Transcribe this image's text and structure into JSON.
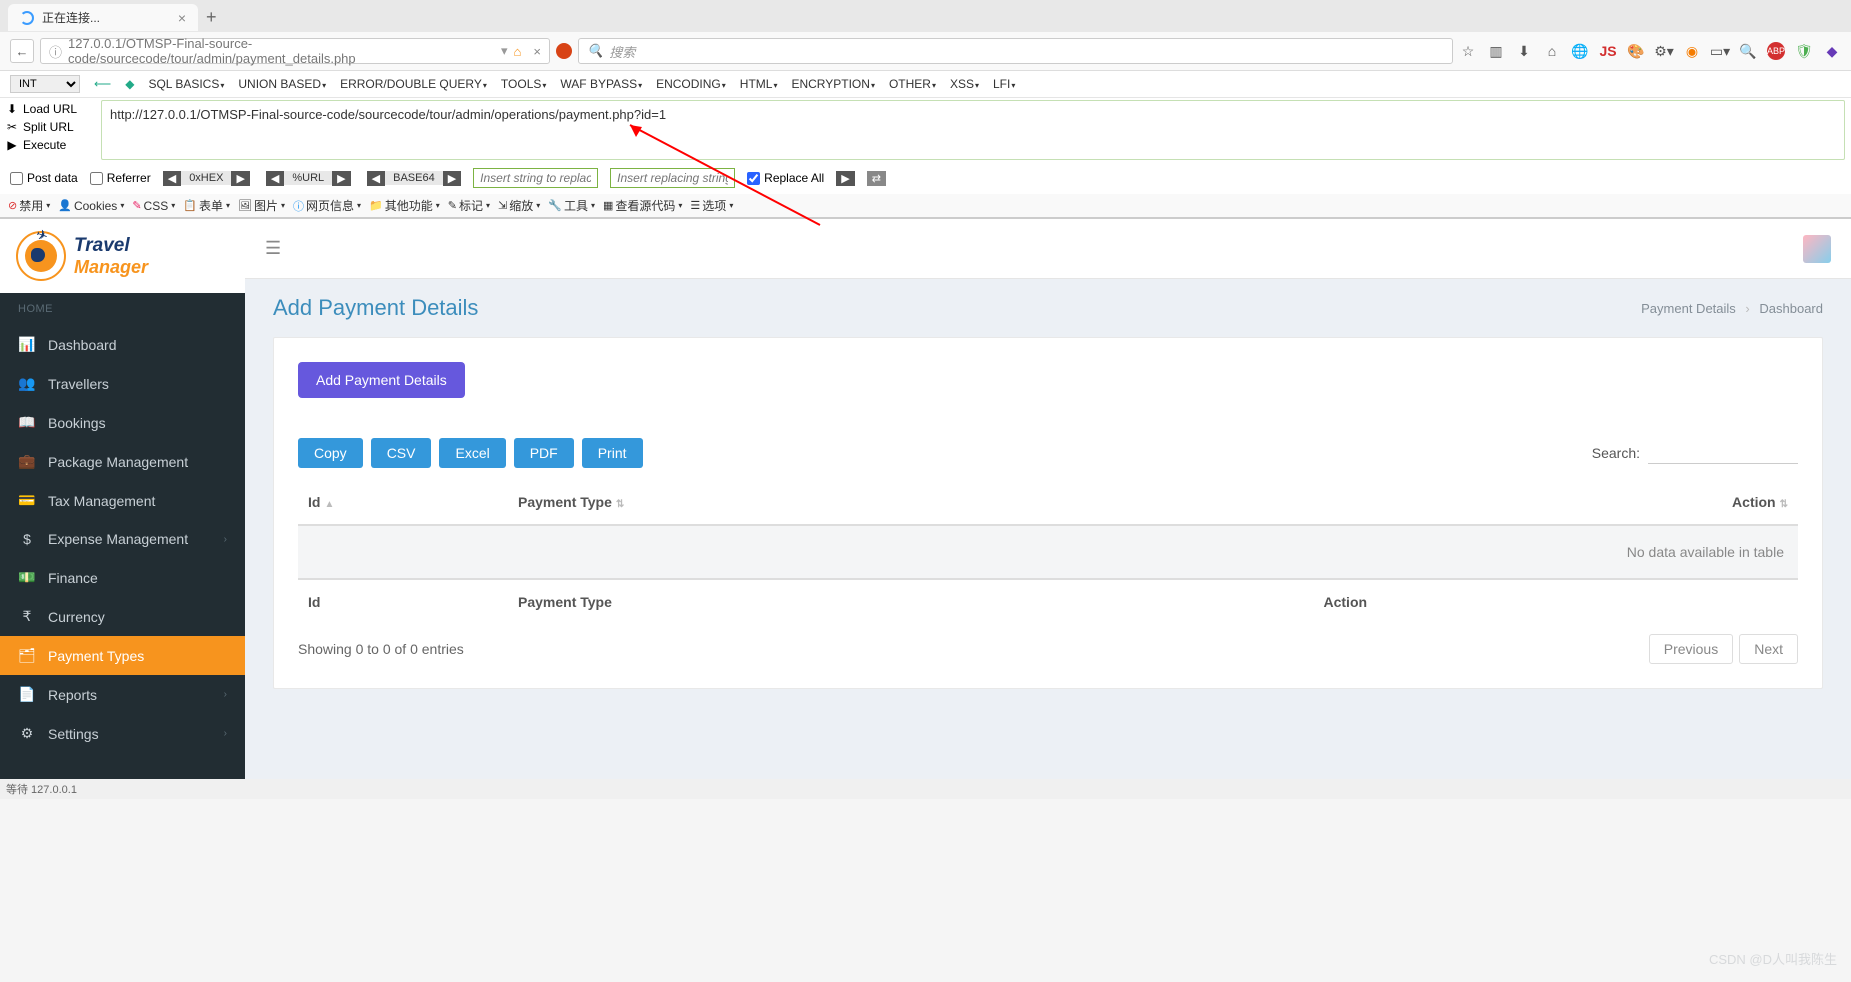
{
  "browser": {
    "tab_title": "正在连接...",
    "url": "127.0.0.1/OTMSP-Final-source-code/sourcecode/tour/admin/payment_details.php",
    "search_placeholder": "搜索",
    "status": "等待 127.0.0.1"
  },
  "hackbar": {
    "select": "INT",
    "menu": [
      "SQL BASICS",
      "UNION BASED",
      "ERROR/DOUBLE QUERY",
      "TOOLS",
      "WAF BYPASS",
      "ENCODING",
      "HTML",
      "ENCRYPTION",
      "OTHER",
      "XSS",
      "LFI"
    ],
    "left": [
      {
        "icon": "⬇",
        "label": "Load URL"
      },
      {
        "icon": "✂",
        "label": "Split URL"
      },
      {
        "icon": "▶",
        "label": "Execute"
      }
    ],
    "url_input": "http://127.0.0.1/OTMSP-Final-source-code/sourcecode/tour/admin/operations/payment.php?id=1",
    "post_data": "Post data",
    "referrer": "Referrer",
    "hex_buttons": [
      "0xHEX",
      "%URL",
      "BASE64"
    ],
    "replace_placeholder1": "Insert string to replace",
    "replace_placeholder2": "Insert replacing string",
    "replace_all": "Replace All"
  },
  "devtools": [
    {
      "icon": "⊘",
      "label": "禁用",
      "color": "#d33"
    },
    {
      "icon": "👤",
      "label": "Cookies"
    },
    {
      "icon": "✎",
      "label": "CSS",
      "color": "#e91e63"
    },
    {
      "icon": "📋",
      "label": "表单"
    },
    {
      "icon": "🖼",
      "label": "图片"
    },
    {
      "icon": "ⓘ",
      "label": "网页信息",
      "color": "#2196f3"
    },
    {
      "icon": "📁",
      "label": "其他功能"
    },
    {
      "icon": "✎",
      "label": "标记"
    },
    {
      "icon": "⇲",
      "label": "缩放"
    },
    {
      "icon": "🔧",
      "label": "工具"
    },
    {
      "icon": "▦",
      "label": "查看源代码"
    },
    {
      "icon": "☰",
      "label": "选项"
    }
  ],
  "logo": {
    "line1": "Travel",
    "line2": "Manager"
  },
  "sidebar": {
    "section": "HOME",
    "items": [
      {
        "icon": "📊",
        "label": "Dashboard"
      },
      {
        "icon": "👥",
        "label": "Travellers"
      },
      {
        "icon": "📖",
        "label": "Bookings"
      },
      {
        "icon": "💼",
        "label": "Package Management"
      },
      {
        "icon": "💳",
        "label": "Tax Management"
      },
      {
        "icon": "$",
        "label": "Expense Management",
        "chev": true
      },
      {
        "icon": "💵",
        "label": "Finance"
      },
      {
        "icon": "₹",
        "label": "Currency"
      },
      {
        "icon": "🗂",
        "label": "Payment Types",
        "active": true
      },
      {
        "icon": "📄",
        "label": "Reports",
        "chev": true
      },
      {
        "icon": "⚙",
        "label": "Settings",
        "chev": true
      }
    ]
  },
  "page": {
    "title": "Add Payment Details",
    "breadcrumb": [
      "Payment Details",
      "Dashboard"
    ],
    "add_button": "Add Payment Details",
    "export_buttons": [
      "Copy",
      "CSV",
      "Excel",
      "PDF",
      "Print"
    ],
    "search_label": "Search:",
    "columns": [
      "Id",
      "Payment Type",
      "Action"
    ],
    "empty_message": "No data available in table",
    "footer_columns": [
      "Id",
      "Payment Type",
      "Action"
    ],
    "info": "Showing 0 to 0 of 0 entries",
    "prev": "Previous",
    "next": "Next"
  },
  "watermark": "CSDN @D人叫我陈生"
}
